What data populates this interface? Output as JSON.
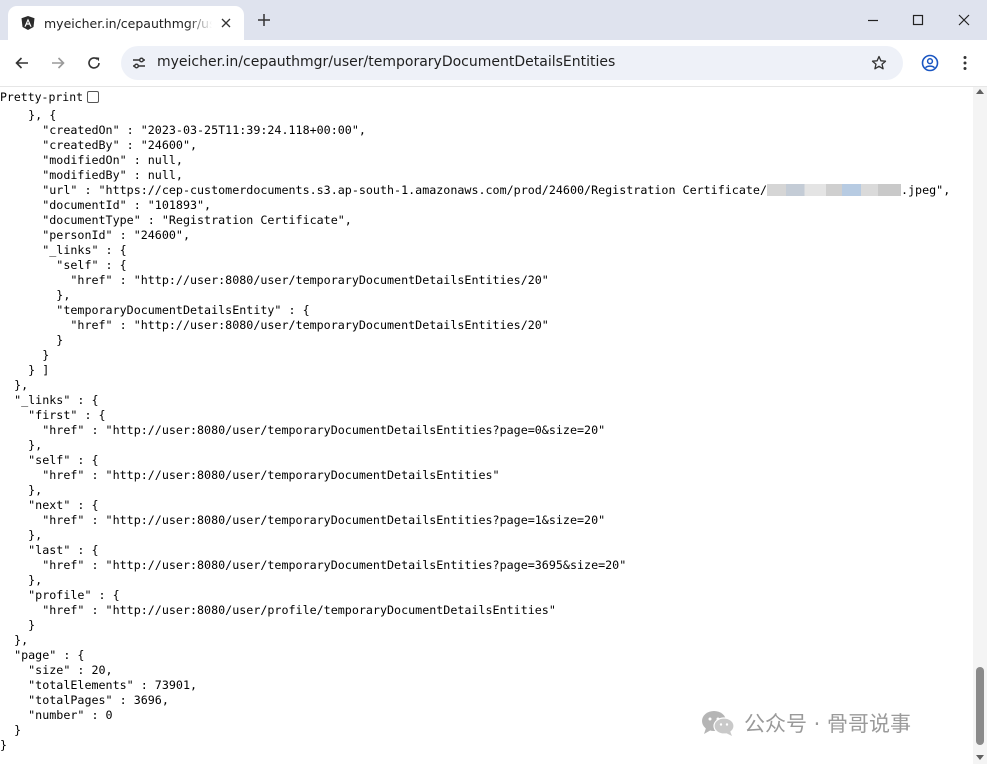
{
  "browser": {
    "tab": {
      "title": "myeicher.in/cepauthmgr/user/temporaryDocumentDetailsEntities",
      "favicon": "angular-icon"
    },
    "address_bar": {
      "url": "myeicher.in/cepauthmgr/user/temporaryDocumentDetailsEntities"
    },
    "icons": {
      "back": "back-arrow-icon",
      "forward": "forward-arrow-icon",
      "reload": "reload-icon",
      "site_info": "tune-icon",
      "bookmark": "star-icon",
      "profile": "profile-icon",
      "menu": "kebab-menu-icon",
      "new_tab": "plus-icon",
      "minimize": "minimize-icon",
      "maximize": "maximize-icon",
      "close": "close-icon"
    }
  },
  "page": {
    "pretty_print_label": "Pretty-print",
    "json": {
      "l01": "    }, {",
      "l02": "      \"createdOn\" : \"2023-03-25T11:39:24.118+00:00\",",
      "l03": "      \"createdBy\" : \"24600\",",
      "l04": "      \"modifiedOn\" : null,",
      "l05": "      \"modifiedBy\" : null,",
      "l06a": "      \"url\" : \"https://cep-customerdocuments.s3.ap-south-1.amazonaws.com/prod/24600/Registration Certificate/",
      "l06b": ".jpeg\",",
      "l07": "      \"documentId\" : \"101893\",",
      "l08": "      \"documentType\" : \"Registration Certificate\",",
      "l09": "      \"personId\" : \"24600\",",
      "l10": "      \"_links\" : {",
      "l11": "        \"self\" : {",
      "l12": "          \"href\" : \"http://user:8080/user/temporaryDocumentDetailsEntities/20\"",
      "l13": "        },",
      "l14": "        \"temporaryDocumentDetailsEntity\" : {",
      "l15": "          \"href\" : \"http://user:8080/user/temporaryDocumentDetailsEntities/20\"",
      "l16": "        }",
      "l17": "      }",
      "l18": "    } ]",
      "l19": "  },",
      "l20": "  \"_links\" : {",
      "l21": "    \"first\" : {",
      "l22": "      \"href\" : \"http://user:8080/user/temporaryDocumentDetailsEntities?page=0&size=20\"",
      "l23": "    },",
      "l24": "    \"self\" : {",
      "l25": "      \"href\" : \"http://user:8080/user/temporaryDocumentDetailsEntities\"",
      "l26": "    },",
      "l27": "    \"next\" : {",
      "l28": "      \"href\" : \"http://user:8080/user/temporaryDocumentDetailsEntities?page=1&size=20\"",
      "l29": "    },",
      "l30": "    \"last\" : {",
      "l31": "      \"href\" : \"http://user:8080/user/temporaryDocumentDetailsEntities?page=3695&size=20\"",
      "l32": "    },",
      "l33": "    \"profile\" : {",
      "l34": "      \"href\" : \"http://user:8080/user/profile/temporaryDocumentDetailsEntities\"",
      "l35": "    }",
      "l36": "  },",
      "l37": "  \"page\" : {",
      "l38": "    \"size\" : 20,",
      "l39": "    \"totalElements\" : 73901,",
      "l40": "    \"totalPages\" : 3696,",
      "l41": "    \"number\" : 0",
      "l42": "  }",
      "l43": "}"
    }
  },
  "watermark": {
    "text": "公众号 · 骨哥说事",
    "icon": "wechat-icon"
  }
}
